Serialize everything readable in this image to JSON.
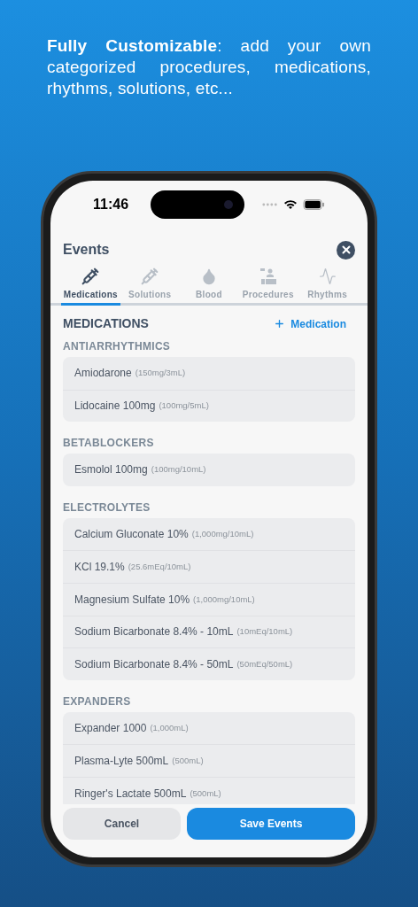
{
  "headline": "**Fully Customizable**: add your own categorized procedures, medications, rhythms, solutions, etc...",
  "status_bar": {
    "time": "11:46"
  },
  "header": {
    "title": "Events"
  },
  "tabs": [
    {
      "label": "Medications",
      "kind": "syringe",
      "selected": true
    },
    {
      "label": "Solutions",
      "kind": "syringe",
      "selected": false
    },
    {
      "label": "Blood",
      "kind": "drop",
      "selected": false
    },
    {
      "label": "Procedures",
      "kind": "procedure",
      "selected": false
    },
    {
      "label": "Rhythms",
      "kind": "pulse",
      "selected": false
    }
  ],
  "section": {
    "title": "MEDICATIONS",
    "add_button": "Medication"
  },
  "groups": [
    {
      "title": "ANTIARRHYTHMICS",
      "items": [
        {
          "name": "Amiodarone",
          "dose": "(150mg/3mL)"
        },
        {
          "name": "Lidocaine 100mg",
          "dose": "(100mg/5mL)"
        }
      ]
    },
    {
      "title": "BETABLOCKERS",
      "items": [
        {
          "name": "Esmolol 100mg",
          "dose": "(100mg/10mL)"
        }
      ]
    },
    {
      "title": "ELECTROLYTES",
      "items": [
        {
          "name": "Calcium Gluconate 10%",
          "dose": "(1,000mg/10mL)"
        },
        {
          "name": "KCl 19.1%",
          "dose": "(25.6mEq/10mL)"
        },
        {
          "name": "Magnesium Sulfate 10%",
          "dose": "(1,000mg/10mL)"
        },
        {
          "name": "Sodium Bicarbonate 8.4% - 10mL",
          "dose": "(10mEq/10mL)"
        },
        {
          "name": "Sodium Bicarbonate 8.4% - 50mL",
          "dose": "(50mEq/50mL)"
        }
      ]
    },
    {
      "title": "EXPANDERS",
      "items": [
        {
          "name": "Expander 1000",
          "dose": "(1,000mL)"
        },
        {
          "name": "Plasma-Lyte 500mL",
          "dose": "(500mL)"
        },
        {
          "name": "Ringer's Lactate 500mL",
          "dose": "(500mL)"
        }
      ]
    }
  ],
  "buttons": {
    "cancel": "Cancel",
    "save": "Save Events"
  }
}
